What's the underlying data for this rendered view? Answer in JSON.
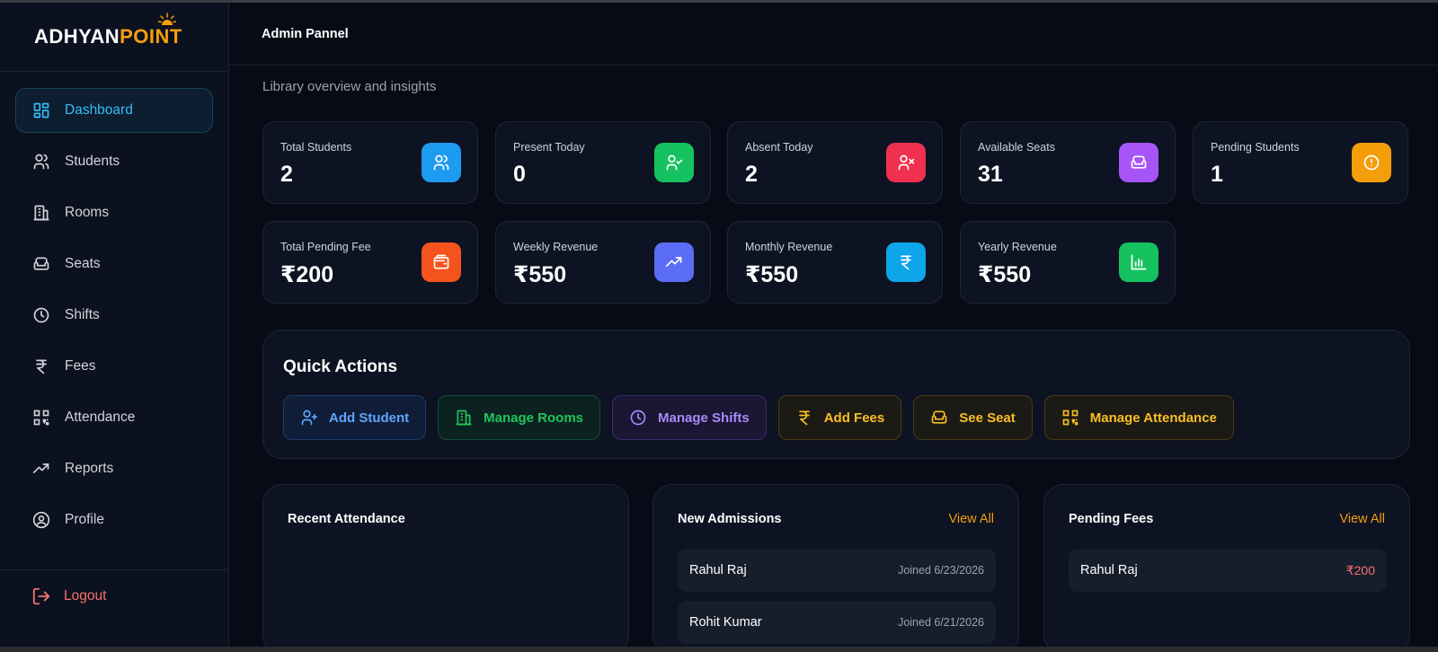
{
  "brand": {
    "logo_main": "ADHYAN",
    "logo_accent": "POINT"
  },
  "sidebar": {
    "items": [
      {
        "label": "Dashboard",
        "icon": "dashboard-icon",
        "active": true
      },
      {
        "label": "Students",
        "icon": "users-icon"
      },
      {
        "label": "Rooms",
        "icon": "building-icon"
      },
      {
        "label": "Seats",
        "icon": "sofa-icon"
      },
      {
        "label": "Shifts",
        "icon": "clock-icon"
      },
      {
        "label": "Fees",
        "icon": "rupee-icon"
      },
      {
        "label": "Attendance",
        "icon": "qr-code-icon"
      },
      {
        "label": "Reports",
        "icon": "trending-up-icon"
      },
      {
        "label": "Profile",
        "icon": "user-circle-icon"
      }
    ],
    "logout_label": "Logout"
  },
  "header": {
    "title": "Admin Pannel"
  },
  "subtitle": "Library overview and insights",
  "stats": [
    {
      "label": "Total Students",
      "value": "2",
      "icon": "users-icon",
      "color": "#1d9bf0"
    },
    {
      "label": "Present Today",
      "value": "0",
      "icon": "user-check-icon",
      "color": "#16c25f"
    },
    {
      "label": "Absent Today",
      "value": "2",
      "icon": "user-x-icon",
      "color": "#f0304f"
    },
    {
      "label": "Available Seats",
      "value": "31",
      "icon": "sofa-icon",
      "color": "#a855f7"
    },
    {
      "label": "Pending Students",
      "value": "1",
      "icon": "alert-circle-icon",
      "color": "#f59e0b"
    },
    {
      "label": "Total Pending Fee",
      "value": "₹200",
      "icon": "wallet-icon",
      "color": "#f5531e"
    },
    {
      "label": "Weekly Revenue",
      "value": "₹550",
      "icon": "trending-up-icon",
      "color": "#5b6cf5"
    },
    {
      "label": "Monthly Revenue",
      "value": "₹550",
      "icon": "rupee-icon",
      "color": "#0ea5e9"
    },
    {
      "label": "Yearly Revenue",
      "value": "₹550",
      "icon": "bar-chart-icon",
      "color": "#16c25f"
    }
  ],
  "quick_actions": {
    "title": "Quick Actions",
    "buttons": [
      {
        "label": "Add Student",
        "icon": "user-plus-icon"
      },
      {
        "label": "Manage Rooms",
        "icon": "building-icon"
      },
      {
        "label": "Manage Shifts",
        "icon": "clock-icon"
      },
      {
        "label": "Add Fees",
        "icon": "rupee-icon"
      },
      {
        "label": "See Seat",
        "icon": "sofa-icon"
      },
      {
        "label": "Manage Attendance",
        "icon": "qr-code-icon"
      }
    ]
  },
  "recent_attendance": {
    "title": "Recent Attendance"
  },
  "new_admissions": {
    "title": "New Admissions",
    "view_all": "View All",
    "rows": [
      {
        "name": "Rahul Raj",
        "meta": "Joined 6/23/2026"
      },
      {
        "name": "Rohit Kumar",
        "meta": "Joined 6/21/2026"
      }
    ]
  },
  "pending_fees": {
    "title": "Pending Fees",
    "view_all": "View All",
    "rows": [
      {
        "name": "Rahul Raj",
        "amount": "₹200"
      }
    ]
  }
}
